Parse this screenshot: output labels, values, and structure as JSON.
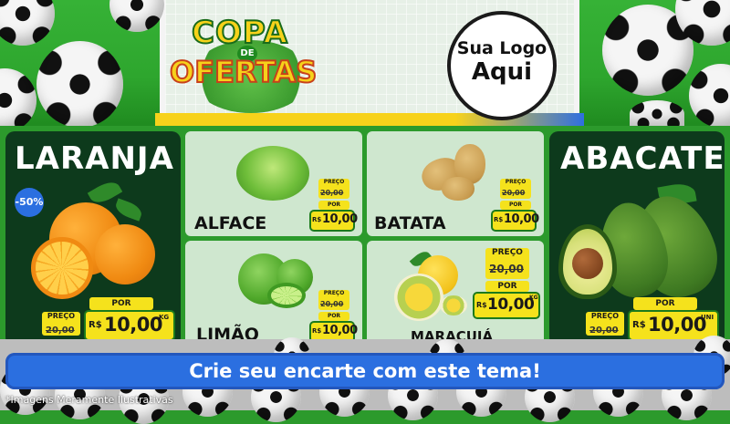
{
  "header": {
    "logo_line1": "COPA",
    "logo_line2": "DE",
    "logo_line3": "OFERTAS",
    "brand_line1": "Sua Logo",
    "brand_line2": "Aqui"
  },
  "products": {
    "laranja": {
      "name": "LARANJA",
      "discount": "-50%",
      "preco_label": "PREÇO",
      "old_price": "20,00",
      "por_label": "POR",
      "currency": "R$",
      "price": "10,00",
      "unit": "KG"
    },
    "alface": {
      "name": "ALFACE",
      "preco_label": "PREÇO",
      "old_price": "20,00",
      "por_label": "POR",
      "currency": "R$",
      "price": "10,00"
    },
    "batata": {
      "name": "BATATA",
      "preco_label": "PREÇO",
      "old_price": "20,00",
      "por_label": "POR",
      "currency": "R$",
      "price": "10,00"
    },
    "limao": {
      "name": "LIMÃO",
      "preco_label": "PREÇO",
      "old_price": "20,00",
      "por_label": "POR",
      "currency": "R$",
      "price": "10,00"
    },
    "maracuja": {
      "name": "MARACUJÁ",
      "preco_label": "PREÇO",
      "old_price": "20,00",
      "por_label": "POR",
      "currency": "R$",
      "price": "10,00",
      "unit": "KG"
    },
    "abacate": {
      "name": "ABACATE",
      "preco_label": "PREÇO",
      "old_price": "20,00",
      "por_label": "POR",
      "currency": "R$",
      "price": "10,00",
      "unit": "UNI"
    }
  },
  "cta": {
    "label": "Crie seu encarte com este tema!"
  },
  "footer": {
    "disclaimer": "*Imagens Meramente Ilustrativas"
  },
  "colors": {
    "field_green": "#2ea62e",
    "dark_panel": "#0d3a1c",
    "light_panel": "#cfe7cf",
    "tag_yellow": "#f5e21c",
    "cta_blue": "#2b6fe0"
  },
  "icons": [
    "soccer-ball-icon"
  ]
}
